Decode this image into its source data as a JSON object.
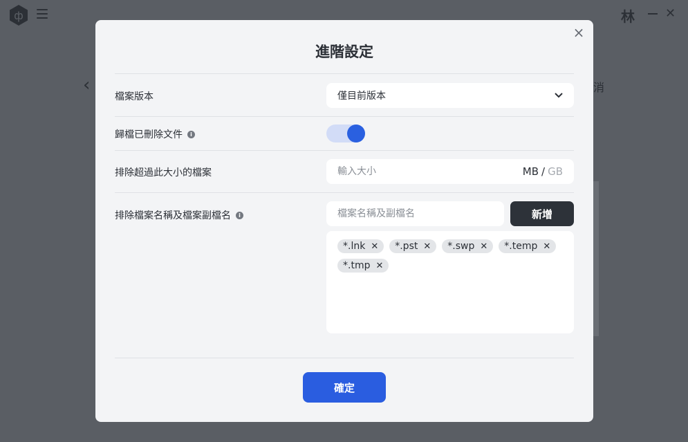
{
  "app": {
    "avatar_text": "林",
    "bg_right_text": "消"
  },
  "modal": {
    "title": "進階設定",
    "close_icon": "close-icon",
    "rows": {
      "file_version": {
        "label": "檔案版本",
        "selected": "僅目前版本"
      },
      "archive_deleted": {
        "label": "歸檔已刪除文件",
        "enabled": true
      },
      "exclude_size": {
        "label": "排除超過此大小的檔案",
        "placeholder": "輸入大小",
        "unit_active": "MB",
        "unit_separator": "/",
        "unit_inactive": "GB"
      },
      "exclude_names": {
        "label": "排除檔案名稱及檔案副檔名",
        "placeholder": "檔案名稱及副檔名",
        "add_label": "新增",
        "tags": [
          "*.lnk",
          "*.pst",
          "*.swp",
          "*.temp",
          "*.tmp"
        ]
      }
    },
    "confirm_label": "確定"
  },
  "colors": {
    "accent": "#2a5de0",
    "dark_button": "#2d3239",
    "toggle_track": "#d2dcf7",
    "overlay": "#5a5e64",
    "modal_bg": "#f3f4f6"
  }
}
